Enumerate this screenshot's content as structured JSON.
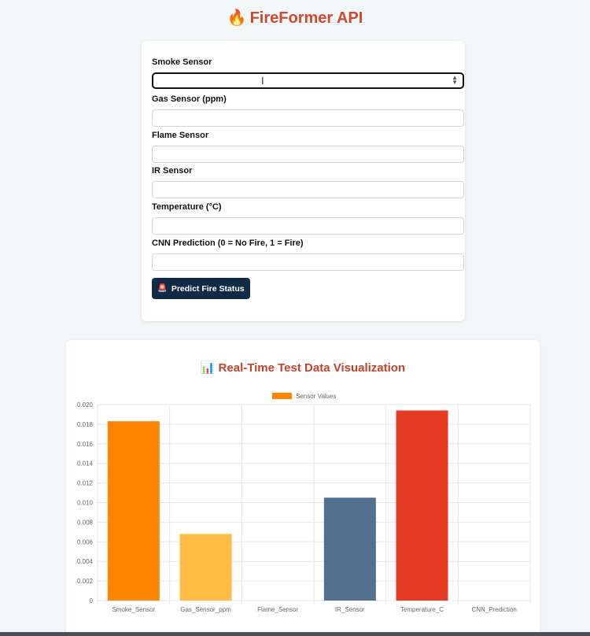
{
  "header": {
    "icon": "fire-icon",
    "icon_glyph": "🔥",
    "title": "FireFormer API"
  },
  "form": {
    "fields": [
      {
        "label": "Smoke Sensor",
        "value": "",
        "type": "select"
      },
      {
        "label": "Gas Sensor (ppm)",
        "value": ""
      },
      {
        "label": "Flame Sensor",
        "value": ""
      },
      {
        "label": "IR Sensor",
        "value": ""
      },
      {
        "label": "Temperature (°C)",
        "value": ""
      },
      {
        "label": "CNN Prediction (0 = No Fire, 1 = Fire)",
        "value": ""
      }
    ],
    "predict_button": {
      "icon": "siren-icon",
      "icon_glyph": "🚨",
      "label": "Predict Fire Status"
    }
  },
  "chart_section": {
    "icon": "bar-chart-icon",
    "icon_glyph": "📊",
    "title": "Real-Time Test Data Visualization"
  },
  "chart_data": {
    "type": "bar",
    "categories": [
      "Smoke_Sensor",
      "Gas_Sensor_ppm",
      "Flame_Sensor",
      "IR_Sensor",
      "Temperature_C",
      "CNN_Prediction"
    ],
    "series": [
      {
        "name": "Sensor Values",
        "values": [
          0.0183,
          0.0068,
          0,
          0.0105,
          0.0194,
          0
        ]
      }
    ],
    "colors": [
      "#ff8500",
      "#ffbd45",
      "#cccccc",
      "#52718e",
      "#e53b24",
      "#aaaaaa"
    ],
    "legend_color": "#ff8500",
    "yticks": [
      "0",
      "0.002",
      "0.004",
      "0.006",
      "0.008",
      "0.010",
      "0.012",
      "0.014",
      "0.016",
      "0.018",
      "0.020"
    ],
    "ylim": [
      0,
      0.02
    ],
    "legend_position": "top-center",
    "grid": true
  }
}
